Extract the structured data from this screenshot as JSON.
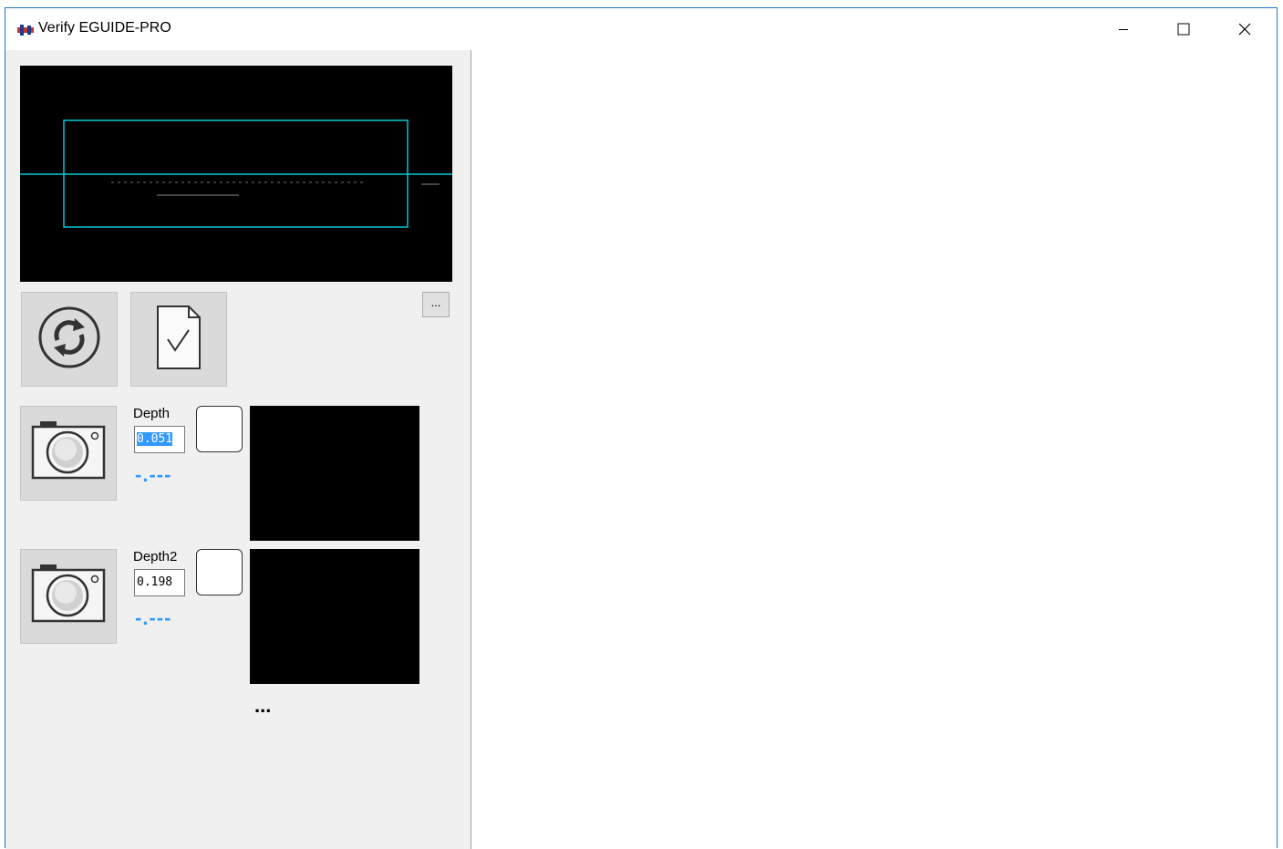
{
  "window": {
    "title": "Verify EGUIDE-PRO",
    "controls": {
      "minimize_icon": "minimize-icon",
      "maximize_icon": "maximize-icon",
      "close_icon": "close-icon"
    }
  },
  "toolbar": {
    "refresh_icon": "refresh-icon",
    "verify_icon": "document-check-icon",
    "more_label": "..."
  },
  "measurements": [
    {
      "label": "Depth",
      "value": "0.051",
      "readout": "-.---",
      "camera_icon": "camera-icon"
    },
    {
      "label": "Depth2",
      "value": "0.198",
      "readout": "-.---",
      "camera_icon": "camera-icon"
    }
  ],
  "footer": {
    "more_label": "..."
  },
  "colors": {
    "accent": "#3399ff",
    "overlay": "#00c8d8",
    "panel_bg": "#f0f0f0",
    "window_border": "#1e78c8"
  }
}
